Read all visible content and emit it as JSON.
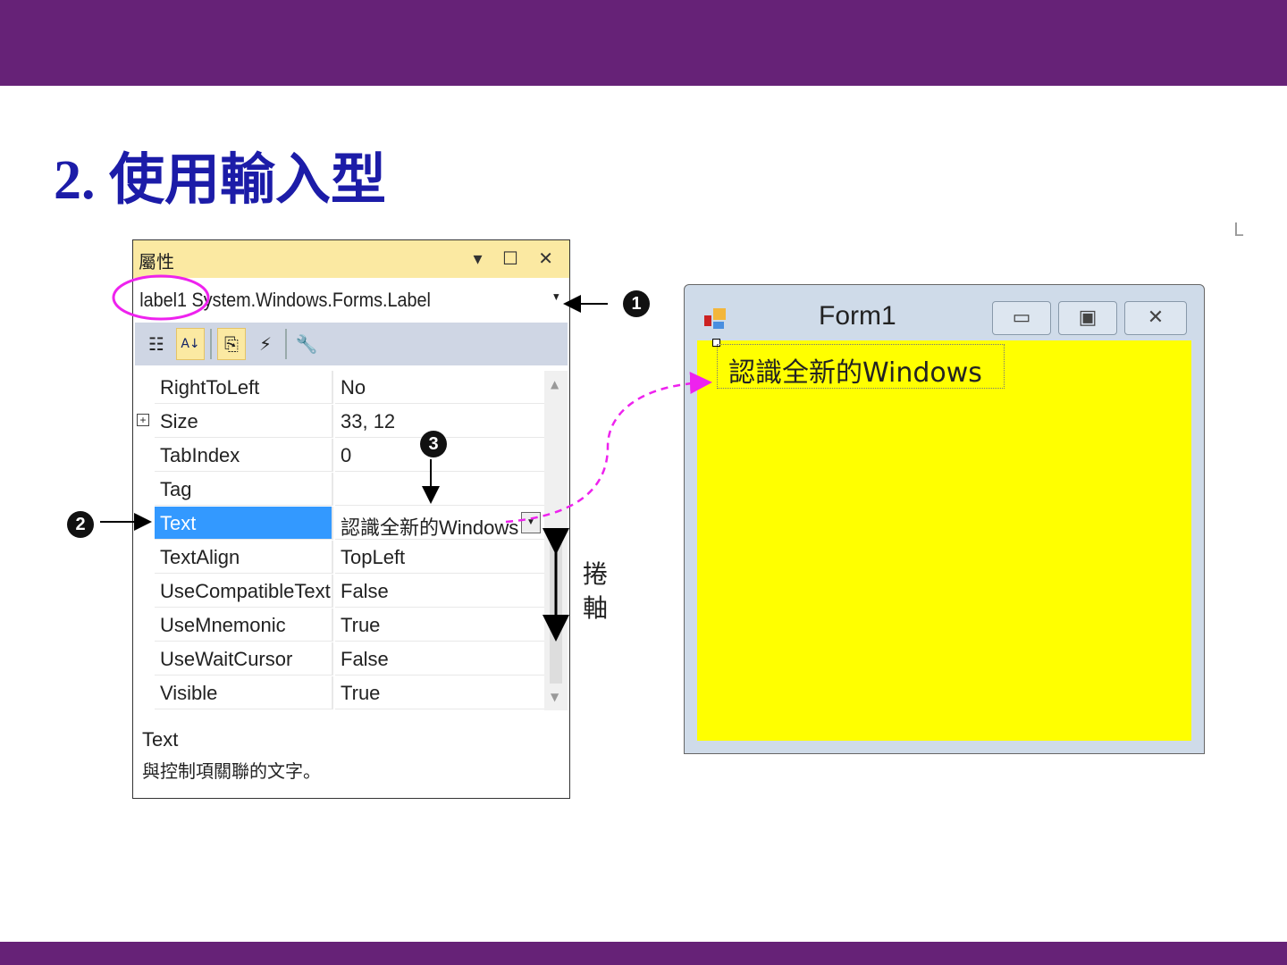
{
  "slide": {
    "title": "2.  使用輸入型",
    "corner_mark": "L"
  },
  "properties": {
    "title": "屬性",
    "window_buttons": "▾ ☐ ✕",
    "object_name": "label1",
    "object_type": "System.Windows.Forms.Label",
    "toolbar": [
      "categorized",
      "alphabetical",
      "properties",
      "events",
      "property-pages"
    ],
    "rows": [
      {
        "name": "RightToLeft",
        "value": "No"
      },
      {
        "name": "Size",
        "value": "33, 12",
        "expand": "⊞"
      },
      {
        "name": "TabIndex",
        "value": "0"
      },
      {
        "name": "Tag",
        "value": ""
      },
      {
        "name": "Text",
        "value": "認識全新的Windows"
      },
      {
        "name": "TextAlign",
        "value": "TopLeft"
      },
      {
        "name": "UseCompatibleTextR",
        "value": "False"
      },
      {
        "name": "UseMnemonic",
        "value": "True"
      },
      {
        "name": "UseWaitCursor",
        "value": "False"
      },
      {
        "name": "Visible",
        "value": "True"
      }
    ],
    "description_title": "Text",
    "description_text": "與控制項關聯的文字。"
  },
  "form": {
    "title": "Form1",
    "label_text": "認識全新的Windows",
    "client_color": "#ffff00"
  },
  "annotations": {
    "n1": "1",
    "n2": "2",
    "n3": "3",
    "scrollbar_label": "捲軸"
  },
  "colors": {
    "brand": "#662277",
    "title": "#1c1ca8",
    "highlight": "#ee22ee",
    "selected": "#3399ff"
  }
}
